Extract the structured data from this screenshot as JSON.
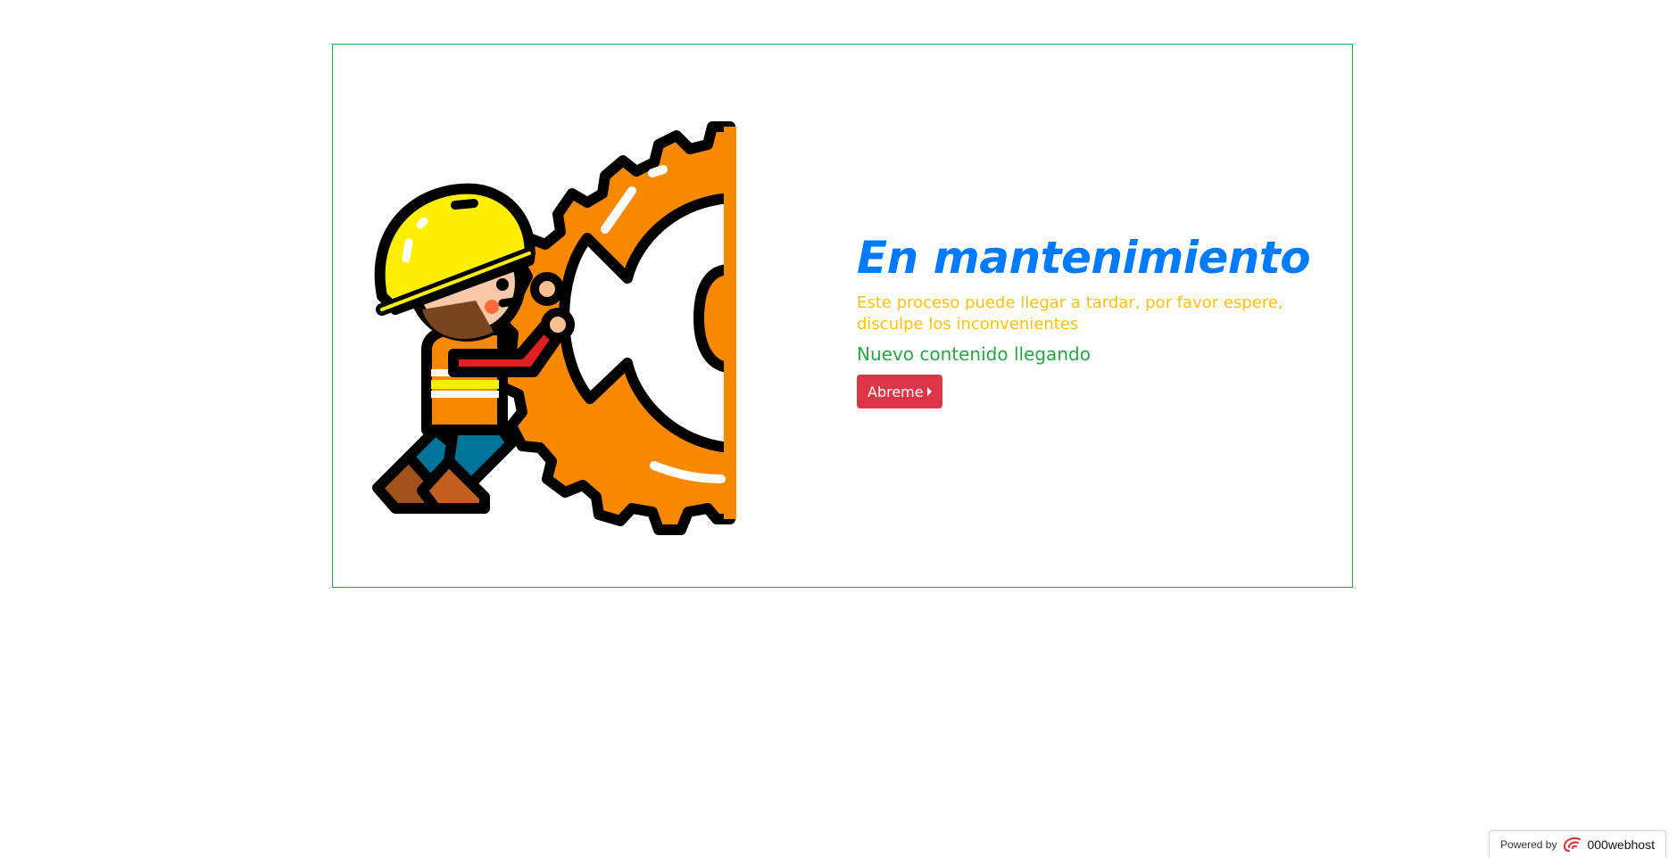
{
  "main": {
    "title": "En mantenimiento",
    "subtitle": "Este proceso puede llegar a tardar, por favor espere, disculpe los inconvenientes",
    "status": "Nuevo contenido llegando",
    "open_button_label": "Abreme"
  },
  "footer": {
    "powered_label": "Powered by",
    "host_name": "000webhost"
  },
  "illustration": {
    "subject": "worker pushing gear",
    "icons": [
      "hard-hat-icon",
      "gear-icon"
    ]
  },
  "colors": {
    "title": "#007bff",
    "subtitle": "#ffc107",
    "status": "#28a745",
    "button": "#dc3545",
    "card_border": "#28a745",
    "gear": "#f88800",
    "helmet": "#ffee00"
  }
}
